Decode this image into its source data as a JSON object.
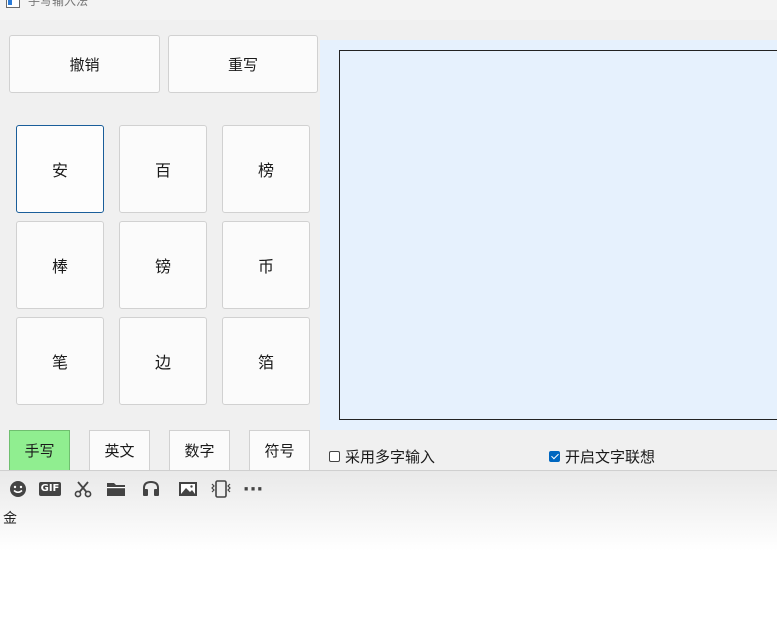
{
  "window": {
    "title": "手写输入法"
  },
  "top_buttons": {
    "undo": "撤销",
    "rewrite": "重写"
  },
  "candidates": [
    "安",
    "百",
    "榜",
    "棒",
    "镑",
    "币",
    "笔",
    "边",
    "箔"
  ],
  "modes": {
    "handwrite": "手写",
    "english": "英文",
    "number": "数字",
    "symbol": "符号"
  },
  "options": {
    "multi_char": {
      "label": "采用多字输入",
      "checked": false
    },
    "association": {
      "label": "开启文字联想",
      "checked": true
    }
  },
  "colors": {
    "active_mode": "#90ee90",
    "canvas_bg": "#e6f1fd",
    "selected_border": "#1a5e9a"
  },
  "toolbar": {
    "icons": [
      "emoji-icon",
      "gif-icon",
      "scissors-icon",
      "folder-icon",
      "audio-icon",
      "image-icon",
      "shake-icon",
      "more-icon"
    ],
    "gif_text": "GIF",
    "more_text": "···"
  },
  "message": {
    "text": "金"
  }
}
